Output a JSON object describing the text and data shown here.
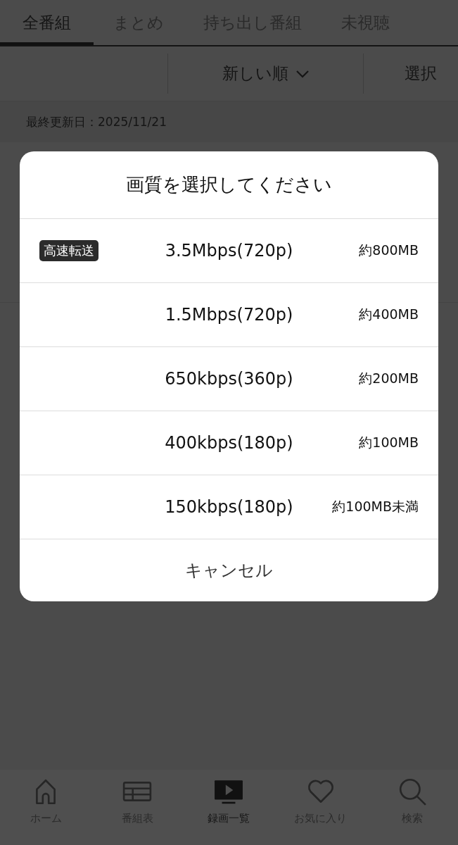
{
  "tabs": [
    {
      "label": "全番組",
      "selected": true
    },
    {
      "label": "まとめ",
      "selected": false
    },
    {
      "label": "持ち出し番組",
      "selected": false
    },
    {
      "label": "未視聴",
      "selected": false
    }
  ],
  "toolbar": {
    "sort": "新しい順",
    "select": "選択"
  },
  "updated": "最終更新日：2025/11/21",
  "dialog": {
    "title": "画質を選択してください",
    "options": [
      {
        "badge": "高速転送",
        "bitrate": "3.5Mbps(720p)",
        "size": "約800MB"
      },
      {
        "bitrate": "1.5Mbps(720p)",
        "size": "約400MB"
      },
      {
        "bitrate": "650kbps(360p)",
        "size": "約200MB"
      },
      {
        "bitrate": "400kbps(180p)",
        "size": "約100MB"
      },
      {
        "bitrate": "150kbps(180p)",
        "size": "約100MB未満"
      }
    ],
    "cancel": "キャンセル"
  },
  "nav": [
    {
      "label": "ホーム",
      "selected": false
    },
    {
      "label": "番組表",
      "selected": false
    },
    {
      "label": "録画一覧",
      "selected": true
    },
    {
      "label": "お気に入り",
      "selected": false
    },
    {
      "label": "検索",
      "selected": false
    }
  ]
}
